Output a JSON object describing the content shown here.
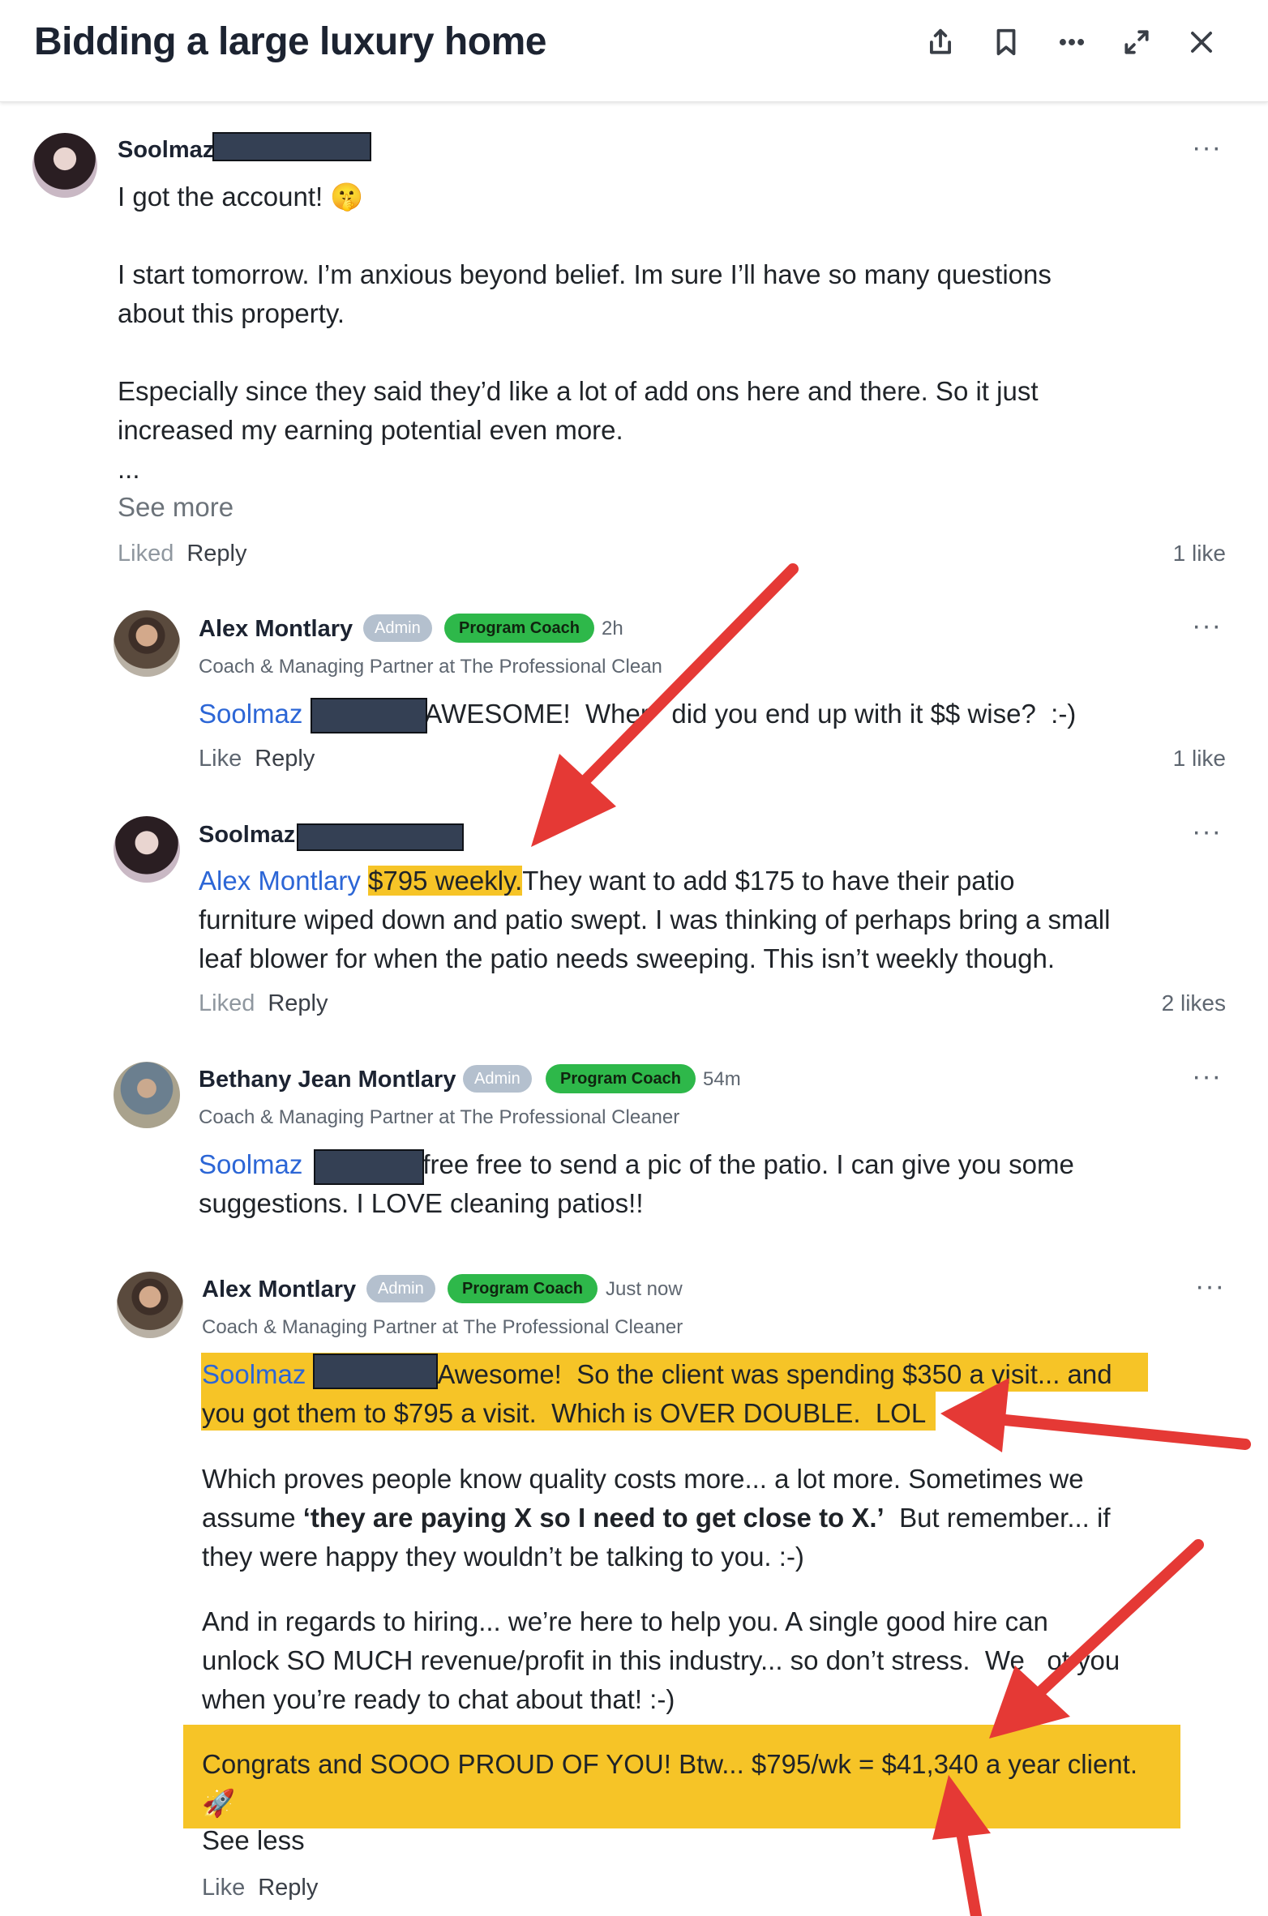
{
  "header": {
    "title": "Bidding a large luxury home",
    "icons": [
      "share-icon",
      "bookmark-icon",
      "more-icon",
      "expand-icon",
      "close-icon"
    ]
  },
  "comments": [
    {
      "author": "Soolmaz",
      "lines": [
        "I got the account! 🤫",
        "I start tomorrow. I’m anxious beyond belief. Im sure I’ll have so many questions",
        "about this property.",
        "Especially since they said they’d like a lot of add ons here and there. So it just",
        "increased my earning potential even more.",
        "..."
      ],
      "see_more": "See more",
      "liked": "Liked",
      "reply": "Reply",
      "likes": "1 like"
    },
    {
      "author": "Alex Montlary",
      "admin": "Admin",
      "coach": "Program Coach",
      "time": "2h",
      "subtitle": "Coach & Managing Partner at The Professional Clean",
      "mention": "Soolmaz",
      "text": "AWESOME!  Wher   did you end up with it $$ wise?  :-)",
      "like": "Like",
      "reply": "Reply",
      "likes": "1 like"
    },
    {
      "author": "Soolmaz",
      "mention": "Alex Montlary",
      "highlight": "$795 weekly.",
      "text1": "They want to add $175 to have their patio",
      "line2": "furniture wiped down and patio swept. I was thinking of perhaps bring a small",
      "line3": "leaf blower for when the patio needs sweeping. This isn’t weekly though.",
      "liked": "Liked",
      "reply": "Reply",
      "likes": "2 likes"
    },
    {
      "author": "Bethany Jean Montlary",
      "admin": "Admin",
      "coach": "Program Coach",
      "time": "54m",
      "subtitle": "Coach & Managing Partner at The Professional Cleaner",
      "mention": "Soolmaz",
      "text1": "free free to send a pic of the patio. I can give you some",
      "line2": "suggestions. I LOVE cleaning patios!!"
    },
    {
      "author": "Alex Montlary",
      "admin": "Admin",
      "coach": "Program Coach",
      "time": "Just now",
      "subtitle": "Coach & Managing Partner at The Professional Cleaner",
      "mention": "Soolmaz",
      "hl_line1": "Awesome!  So the client was spending $350 a visit... and",
      "hl_line2": "you got them to $795 a visit.  Which is OVER DOUBLE.  LOL",
      "p2_line1": "Which proves people know quality costs more... a lot more.  Sometimes we",
      "p2_line2a": "assume ",
      "p2_line2b": "‘they are paying X so I need to get close to X.’",
      "p2_line2c": "  But remember... if",
      "p2_line3": "they were happy they wouldn’t be talking to you.  :-)",
      "p3_line1": "And in regards to hiring... we’re here to help you.  A single good hire can",
      "p3_line2": "unlock SO MUCH revenue/profit in this industry... so don’t stress.  We   ot you",
      "p3_line3": "when you’re ready to chat about that!  :-)",
      "p4_line1": "Congrats and SOOO PROUD OF YOU!  Btw... $795/wk = $41,340 a year client.",
      "p4_line2": "🚀",
      "see_less": "See less",
      "like": "Like",
      "reply": "Reply"
    }
  ],
  "colors": {
    "highlight": "#f6c427",
    "mention": "#2c66d6",
    "coach_badge": "#2eb84a",
    "admin_badge": "#b4c0ce",
    "arrow": "#e53935"
  }
}
